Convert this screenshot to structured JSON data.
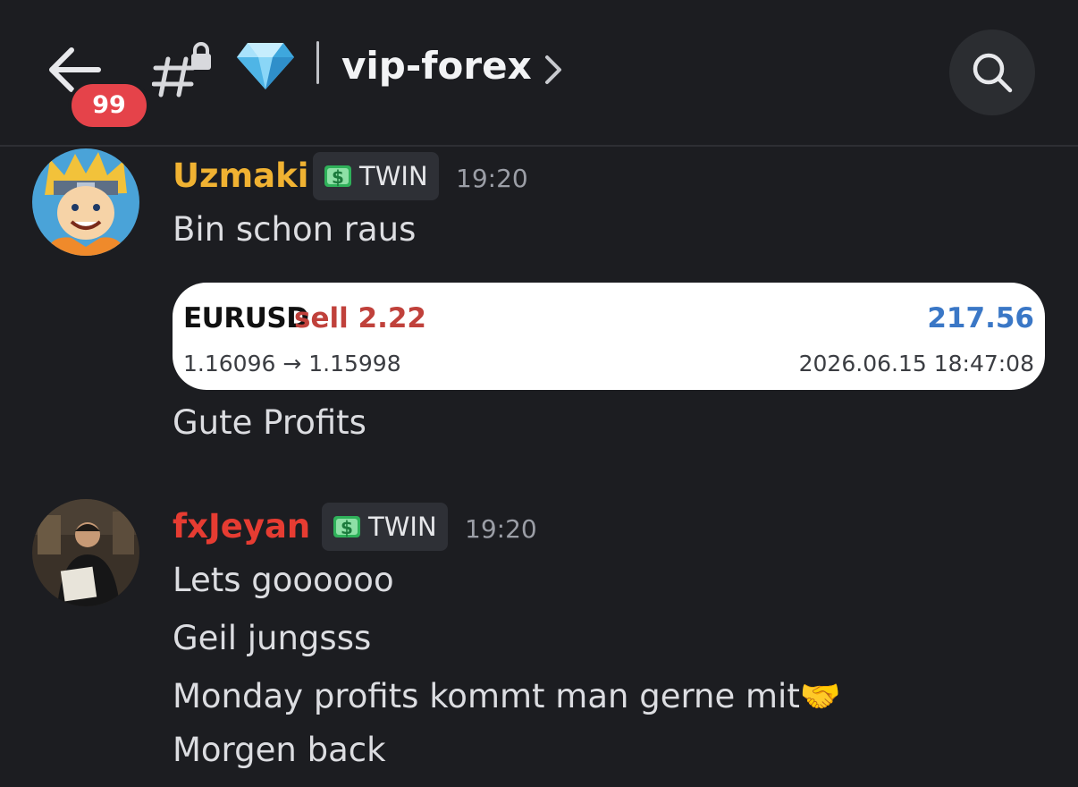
{
  "header": {
    "unread_badge": "99",
    "channel_name": "vip-forex"
  },
  "messages": [
    {
      "username": "Uzmaki",
      "username_color": "#f0b232",
      "role": "TWIN",
      "time": "19:20",
      "lines": [
        "Bin schon raus"
      ],
      "trade": {
        "symbol": "EURUSD",
        "side": "sell 2.22",
        "profit": "217.56",
        "prices": "1.16096 → 1.15998",
        "datetime": "2026.06.15 18:47:08"
      },
      "after": "Gute Profits"
    },
    {
      "username": "fxJeyan",
      "username_color": "#e63c32",
      "role": "TWIN",
      "time": "19:20",
      "lines": [
        "Lets goooooo",
        "Geil jungsss",
        "Monday profits kommt man gerne mit🤝",
        "Morgen back"
      ]
    }
  ]
}
